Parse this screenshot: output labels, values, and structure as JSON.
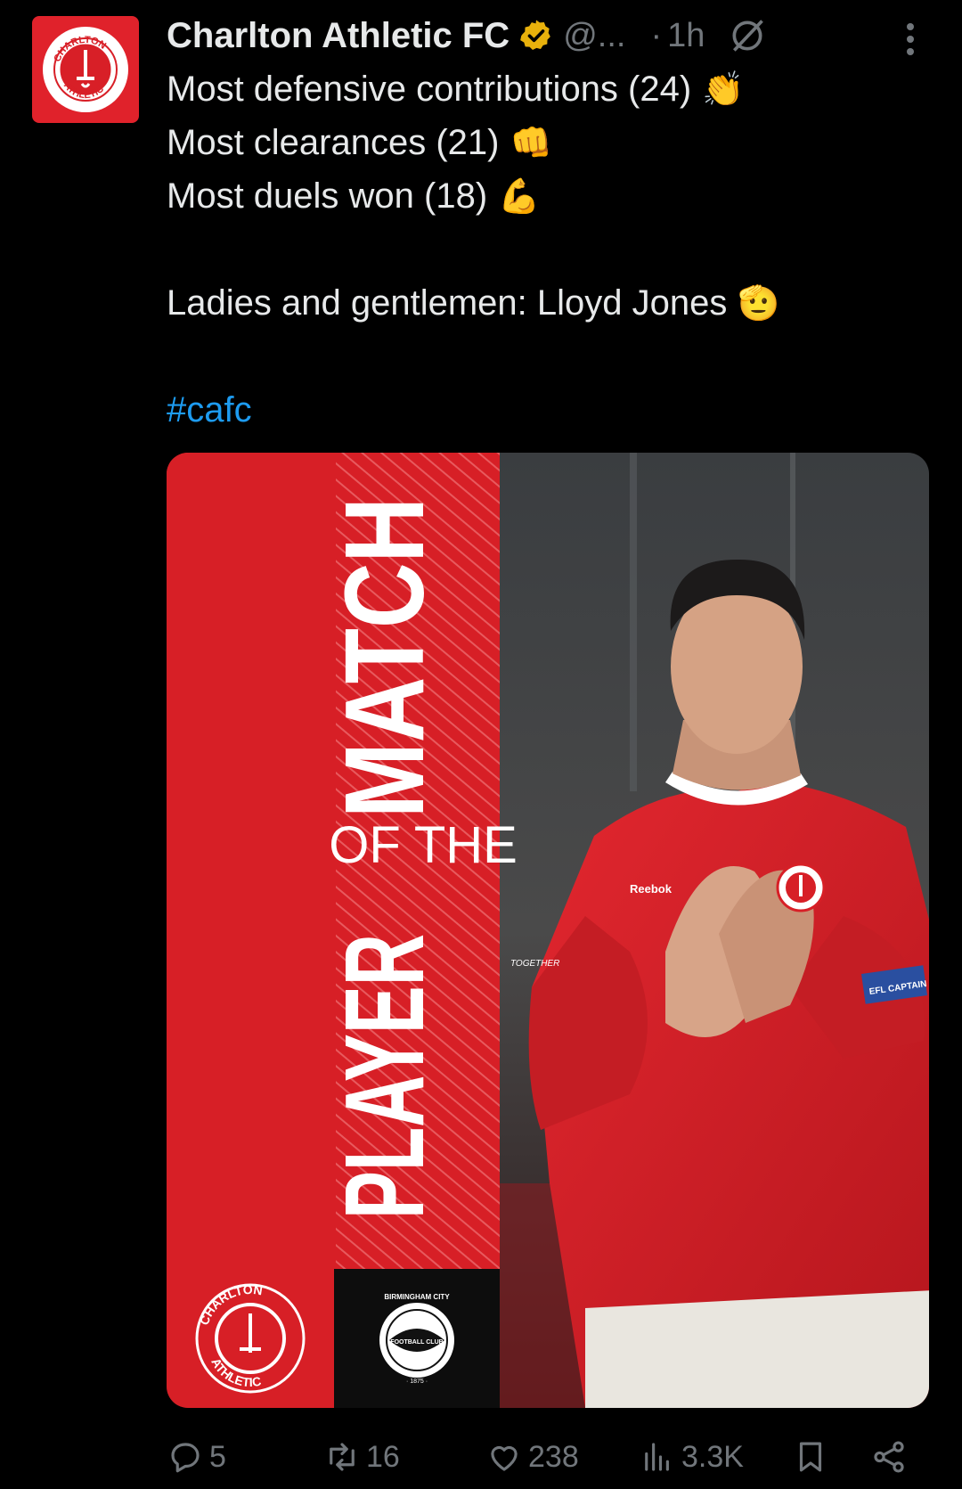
{
  "account": {
    "name": "Charlton Athletic FC",
    "handle": "@...",
    "separator": "·",
    "time": "1h",
    "avatar_text_top": "CHARLTON",
    "avatar_text_bottom": "ATHLETIC"
  },
  "tweet": {
    "lines": [
      {
        "text": "Most defensive contributions (24)",
        "emoji": "👏"
      },
      {
        "text": "Most clearances (21)",
        "emoji": "👊"
      },
      {
        "text": "Most duels won (18)",
        "emoji": "💪"
      }
    ],
    "closing": {
      "text": "Ladies and gentlemen: Lloyd Jones",
      "emoji": "🫡"
    },
    "hashtag": "#cafc"
  },
  "media": {
    "title_top": "MATCH",
    "title_mid": "OF THE",
    "title_bottom": "PLAYER",
    "home_badge_top": "CHARLTON",
    "home_badge_bottom": "ATHLETIC",
    "away_badge_top": "BIRMINGHAM CITY",
    "away_badge_mid": "FOOTBALL CLUB",
    "away_badge_year": "· 1875 ·",
    "shirt_sponsor": "Reebok",
    "captain_band": "EFL CAPTAIN",
    "sleeve_text": "TOGETHER"
  },
  "actions": {
    "replies": "5",
    "reposts": "16",
    "likes": "238",
    "views": "3.3K"
  },
  "icons": [
    "verified-badge-icon",
    "grok-icon",
    "more-icon",
    "reply-icon",
    "repost-icon",
    "like-icon",
    "views-icon",
    "bookmark-icon",
    "share-icon"
  ],
  "colors": {
    "brand_red": "#e0222b",
    "link_blue": "#1d9bf0",
    "muted": "#71767b",
    "verified_gold": "#e8b10c"
  }
}
